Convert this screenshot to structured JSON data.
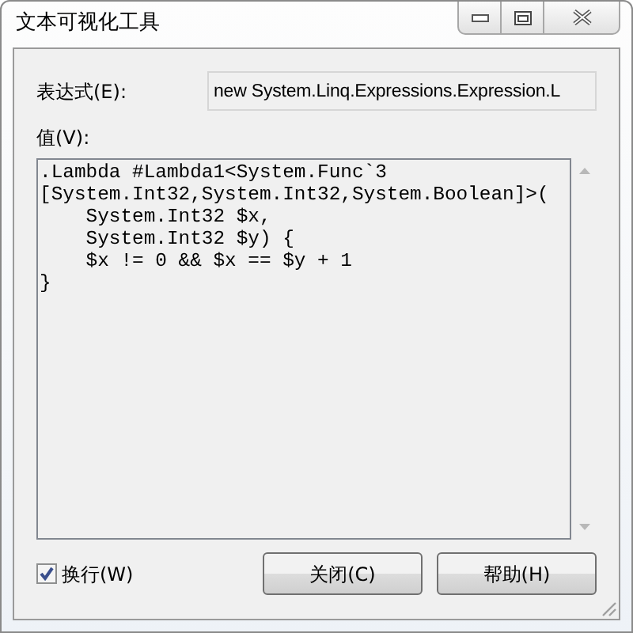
{
  "window": {
    "title": "文本可视化工具"
  },
  "expression": {
    "label": "表达式(E):",
    "value": "new System.Linq.Expressions.Expression.L"
  },
  "value": {
    "label": "值(V):",
    "lines": [
      ".Lambda #Lambda1<System.Func`3",
      "[System.Int32,System.Int32,System.Boolean]>(",
      "    System.Int32 $x,",
      "    System.Int32 $y) {",
      "    $x != 0 && $x == $y + 1",
      "}"
    ]
  },
  "wrap": {
    "label": "换行(W)",
    "checked": true
  },
  "buttons": [
    "关闭(C)",
    "帮助(H)"
  ]
}
